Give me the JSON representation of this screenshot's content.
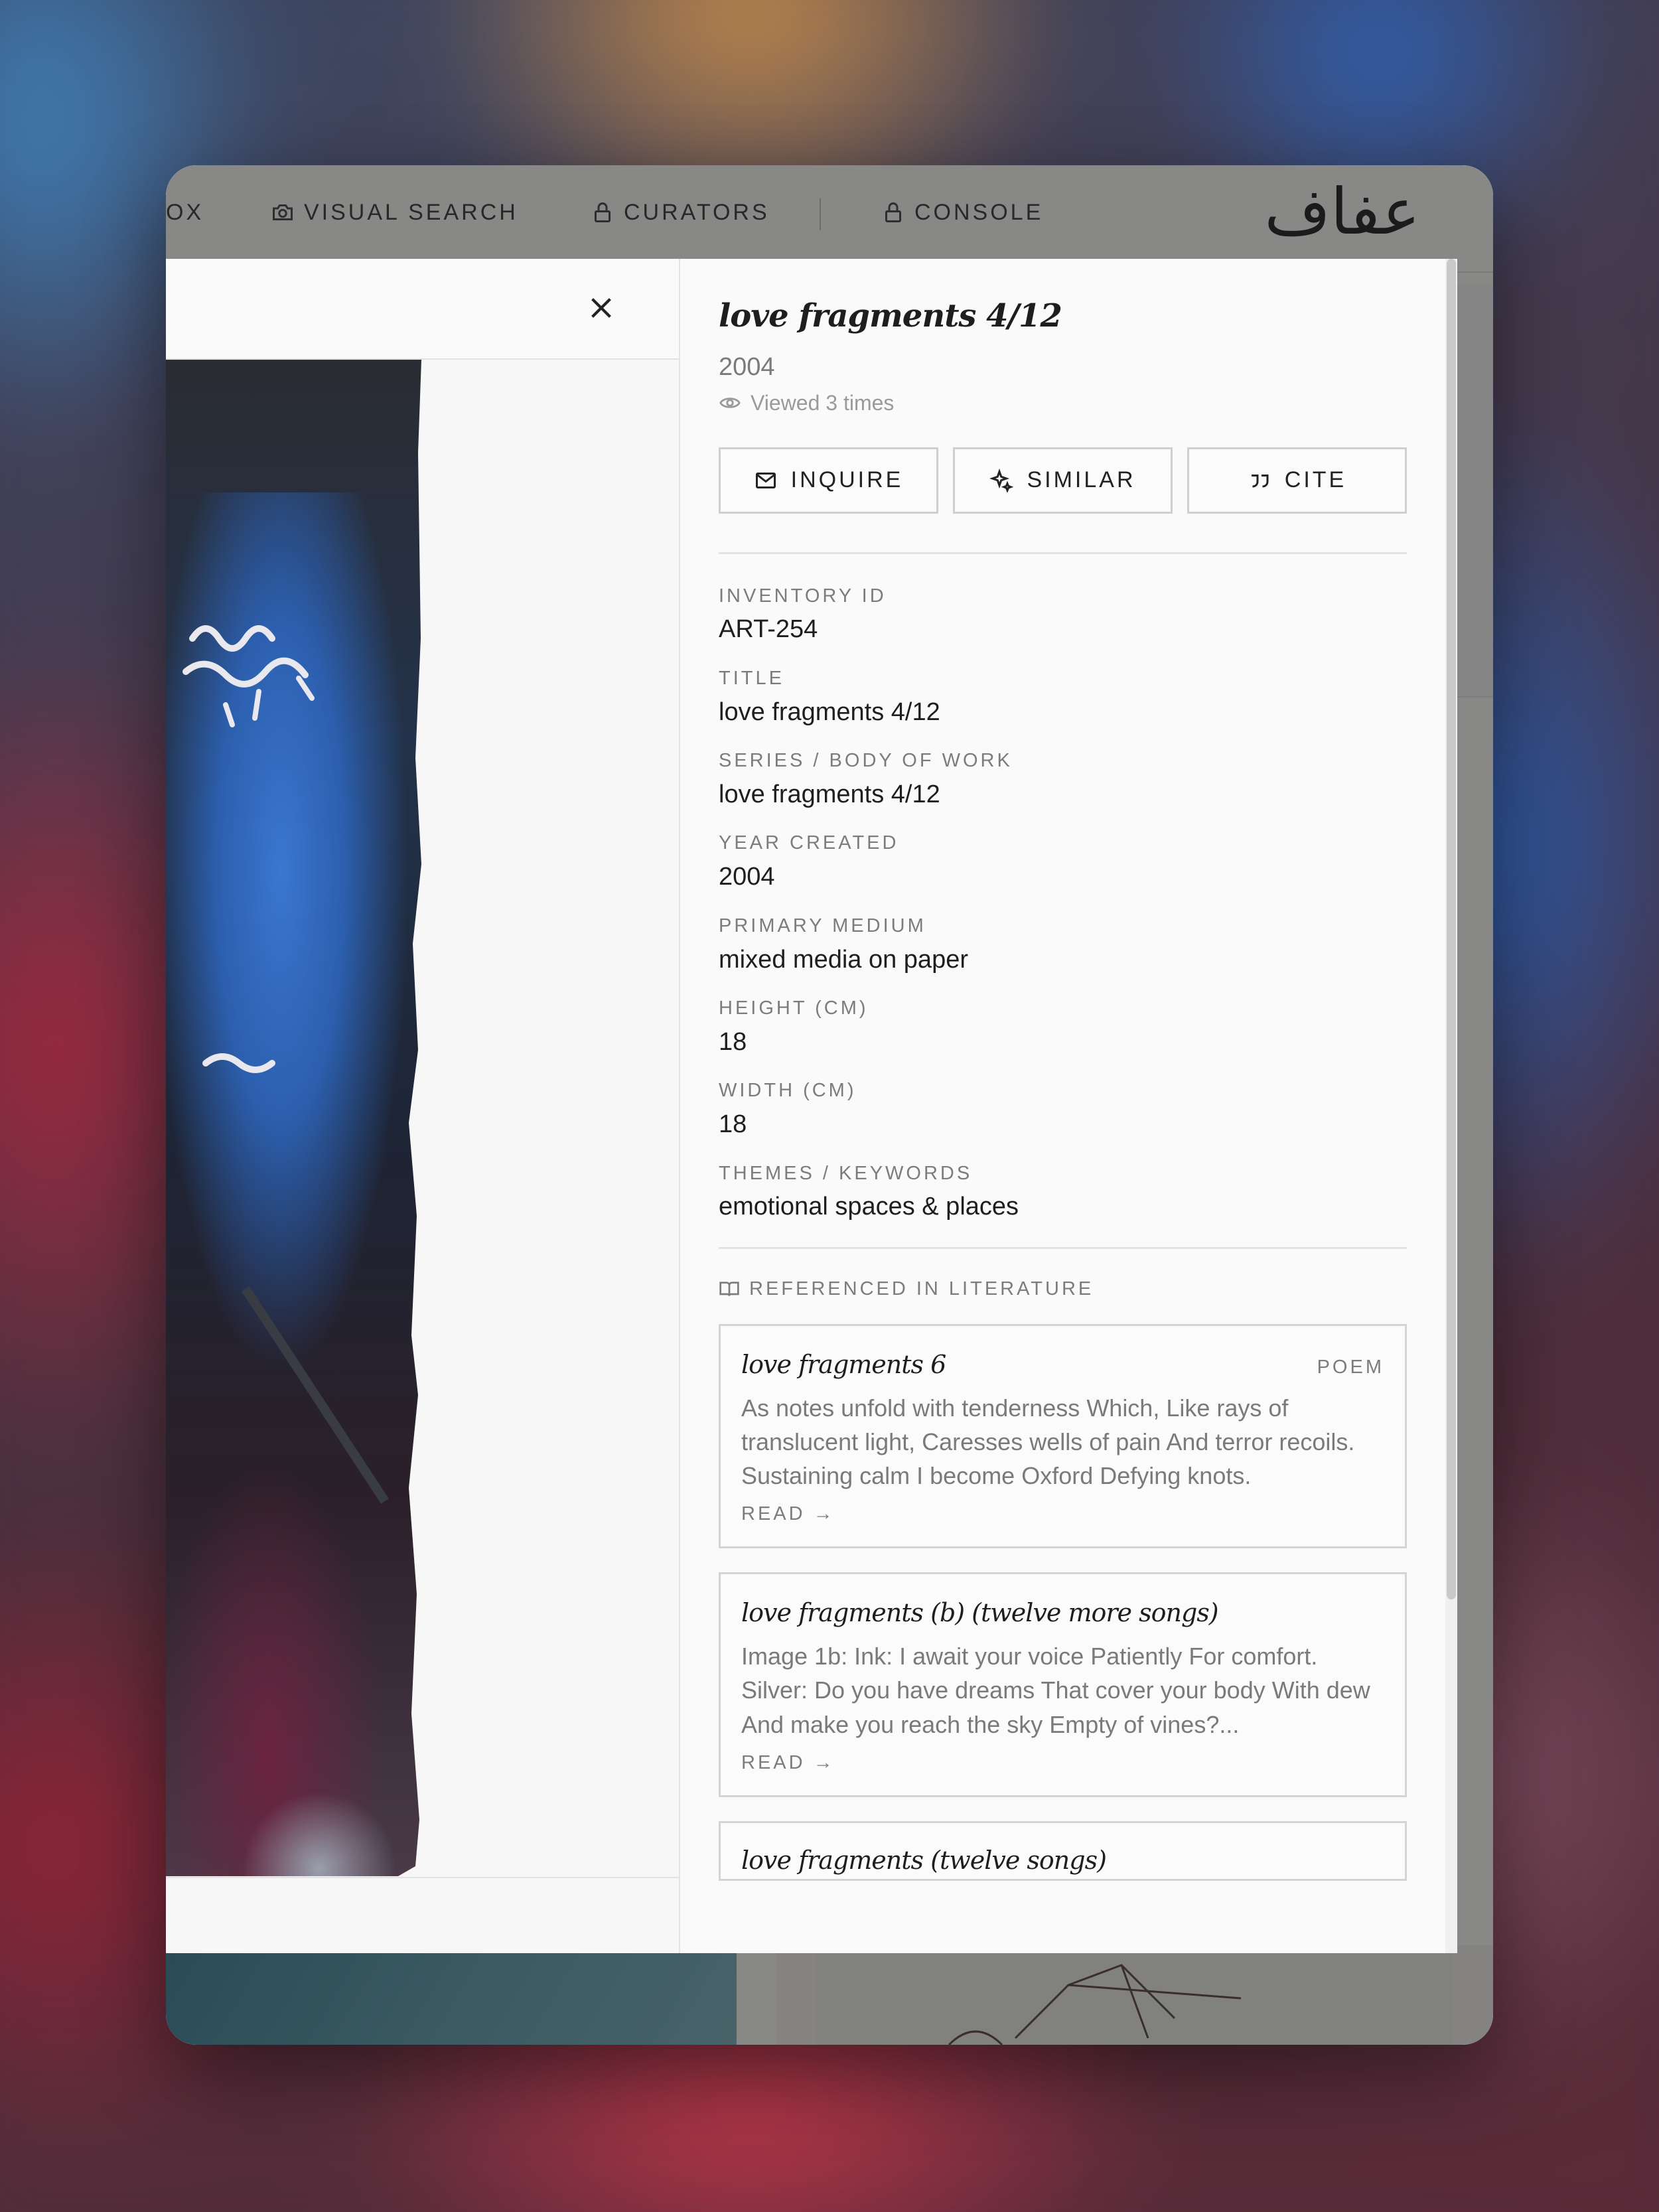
{
  "nav": {
    "items": [
      {
        "label": "OX",
        "icon": "none"
      },
      {
        "label": "VISUAL SEARCH",
        "icon": "camera-icon"
      },
      {
        "label": "CURATORS",
        "icon": "lock-icon"
      },
      {
        "label": "CONSOLE",
        "icon": "lock-icon"
      }
    ],
    "logo_text": "عفاف"
  },
  "artwork": {
    "title": "love fragments 4/12",
    "year": "2004",
    "views": "Viewed 3 times"
  },
  "actions": {
    "inquire": "INQUIRE",
    "similar": "SIMILAR",
    "cite": "CITE"
  },
  "fields": [
    {
      "label": "INVENTORY ID",
      "value": "ART-254"
    },
    {
      "label": "TITLE",
      "value": "love fragments 4/12"
    },
    {
      "label": "SERIES / BODY OF WORK",
      "value": "love fragments 4/12"
    },
    {
      "label": "YEAR CREATED",
      "value": "2004"
    },
    {
      "label": "PRIMARY MEDIUM",
      "value": "mixed media on paper"
    },
    {
      "label": "HEIGHT (CM)",
      "value": "18"
    },
    {
      "label": "WIDTH (CM)",
      "value": "18"
    },
    {
      "label": "THEMES / KEYWORDS",
      "value": "emotional spaces & places"
    }
  ],
  "literature": {
    "heading": "REFERENCED IN LITERATURE",
    "read_label": "READ →",
    "items": [
      {
        "title": "love fragments 6",
        "type": "POEM",
        "excerpt": "As notes unfold with tenderness Which, Like rays of translucent light, Caresses wells of pain And terror recoils. Sustaining calm I become Oxford Defying knots."
      },
      {
        "title": "love fragments (b) (twelve more songs)",
        "type": "",
        "excerpt": "Image 1b: Ink: I await your voice Patiently For comfort. Silver: Do you have dreams That cover your body With dew And make you reach the sky Empty of vines?..."
      },
      {
        "title": "love fragments (twelve songs)",
        "type": "",
        "excerpt": ""
      }
    ]
  },
  "colors": {
    "panel": "#fafafa",
    "border": "#d4d4d4",
    "text": "#1e1e1e",
    "muted": "#7c7c7c",
    "art_blue": "#2c63b5",
    "art_dark": "#1c1f28"
  }
}
